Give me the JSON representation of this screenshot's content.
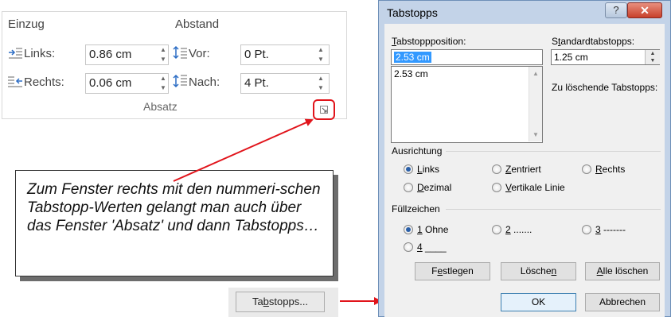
{
  "ribbon": {
    "einzug_label": "Einzug",
    "abstand_label": "Abstand",
    "links_label": "Links:",
    "links_value": "0.86 cm",
    "rechts_label": "Rechts:",
    "rechts_value": "0.06 cm",
    "vor_label": "Vor:",
    "vor_value": "0 Pt.",
    "nach_label": "Nach:",
    "nach_value": "4 Pt.",
    "group_label": "Absatz"
  },
  "callout": {
    "text": "Zum Fenster rechts mit den nummeri-schen Tabstopp-Werten gelangt man auch über das Fenster 'Absatz' und dann Tabstopps…"
  },
  "tabstopps_button": {
    "pre": "Ta",
    "underline": "b",
    "post": "stopps..."
  },
  "dialog": {
    "title": "Tabstopps",
    "help": "?",
    "close": "✕",
    "position_label": {
      "underline": "T",
      "rest": "abstoppposition:"
    },
    "position_value": "2.53 cm",
    "list_items": [
      "2.53 cm"
    ],
    "standard_label": {
      "pre": "S",
      "underline": "t",
      "rest": "andardtabstopps:"
    },
    "standard_value": "1.25 cm",
    "delete_label": "Zu löschende Tabstopps:",
    "ausrichtung_label": "Ausrichtung",
    "align": {
      "links": {
        "u": "L",
        "rest": "inks"
      },
      "zentriert": {
        "u": "Z",
        "rest": "entriert"
      },
      "rechts": {
        "u": "R",
        "rest": "echts"
      },
      "dezimal": {
        "u": "D",
        "rest": "ezimal"
      },
      "vertikal": {
        "u": "V",
        "rest": "ertikale Linie"
      }
    },
    "fill_label": "Füllzeichen",
    "fill": {
      "f1": {
        "u": "1",
        "rest": " Ohne"
      },
      "f2": {
        "u": "2",
        "rest": " ......."
      },
      "f3": {
        "u": "3",
        "rest": " -------"
      },
      "f4": {
        "u": "4",
        "rest": " ____"
      }
    },
    "buttons": {
      "festlegen": {
        "pre": "F",
        "u": "e",
        "rest": "stlegen"
      },
      "loeschen": {
        "pre": "Lösche",
        "u": "n",
        "rest": ""
      },
      "alle": {
        "pre": "",
        "u": "A",
        "rest": "lle löschen"
      },
      "ok": "OK",
      "abbrechen": "Abbrechen"
    }
  },
  "colors": {
    "highlight": "#e1141b",
    "arrow": "#e1141b",
    "selection": "#3399ff"
  }
}
